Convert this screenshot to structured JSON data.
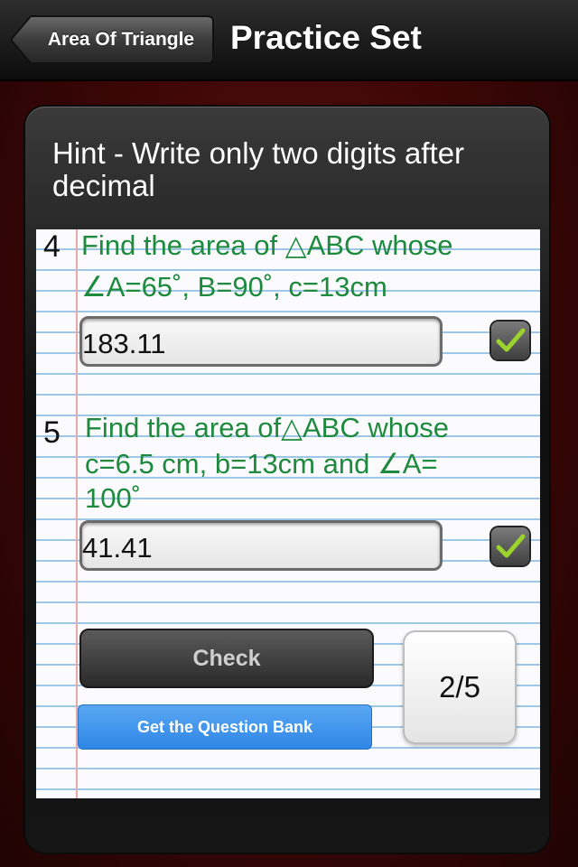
{
  "navbar": {
    "back_label": "Area Of Triangle",
    "title": "Practice Set"
  },
  "hint": "Hint - Write only two digits after decimal",
  "questions": [
    {
      "number": "4",
      "line1": "Find the area of △ABC whose",
      "line2": "∠A=65˚, B=90˚, c=13cm",
      "answer": "183.11",
      "checked": true
    },
    {
      "number": "5",
      "line1": "Find the area of△ABC whose",
      "line2": "c=6.5 cm, b=13cm and ∠A=",
      "line3": "100˚",
      "answer": "41.41",
      "checked": true
    }
  ],
  "buttons": {
    "check_label": "Check",
    "question_bank_label": "Get the Question Bank"
  },
  "progress": "2/5",
  "colors": {
    "question_text": "#1e8a3e",
    "check_mark": "#9bd32c",
    "bank_button": "#3b8fea"
  }
}
